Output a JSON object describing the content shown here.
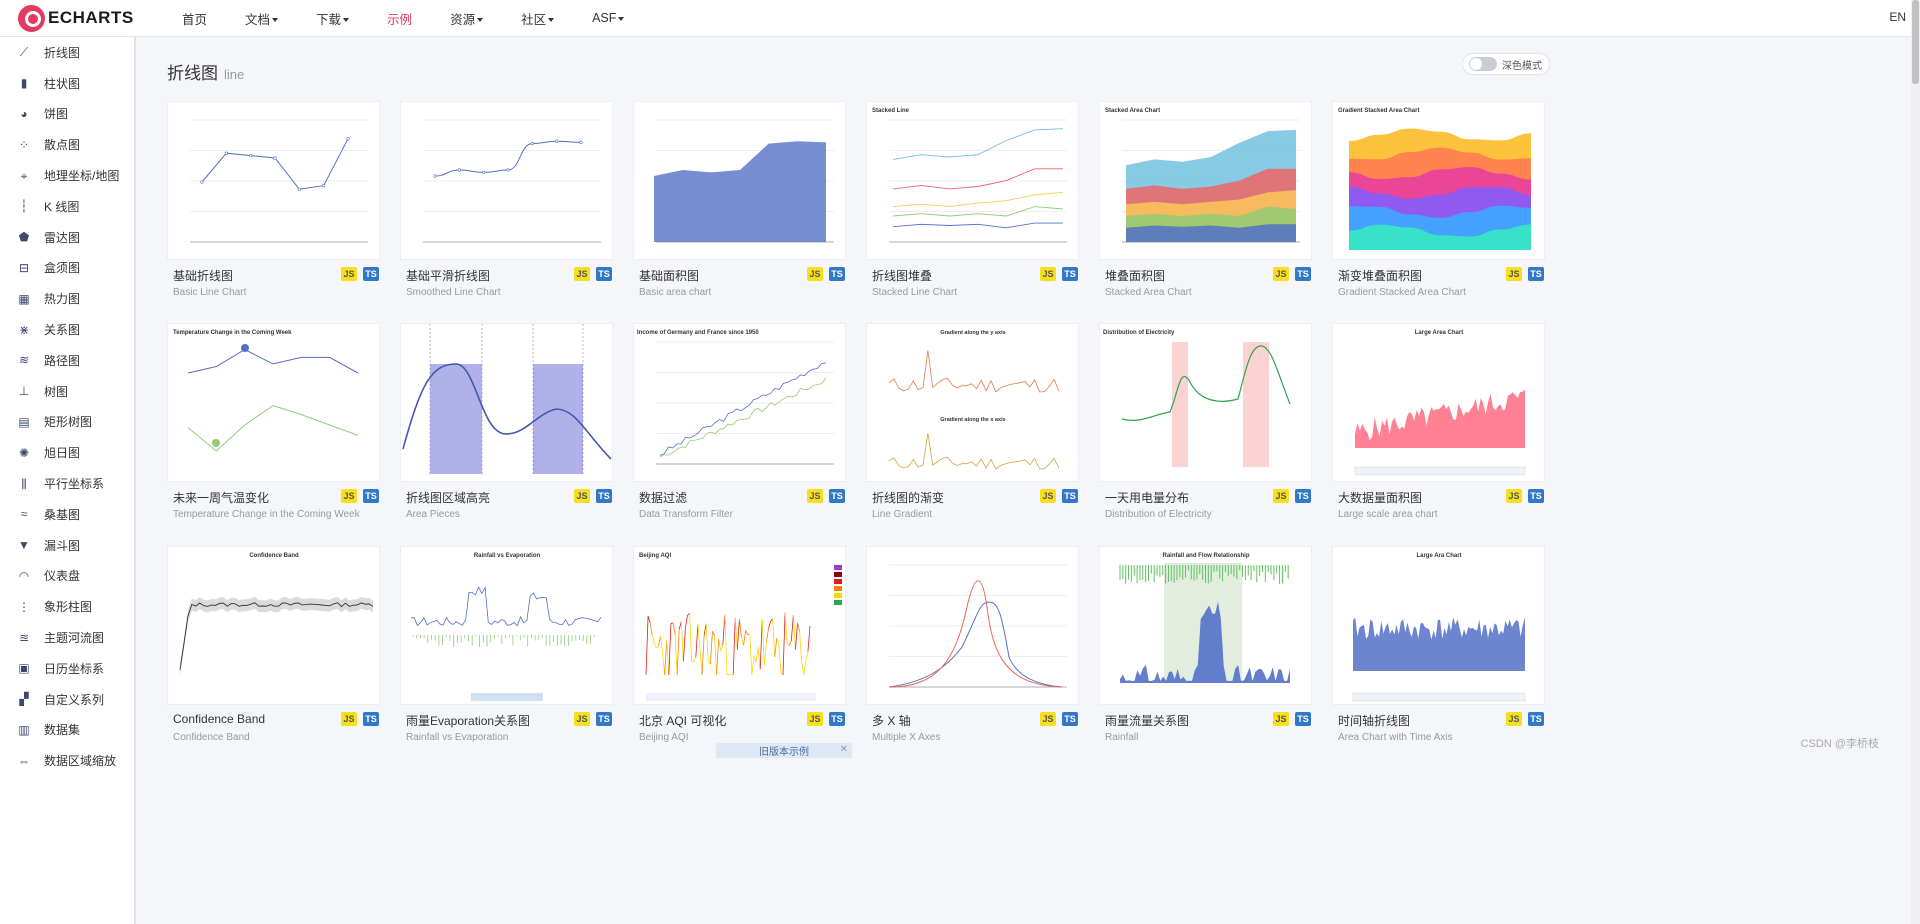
{
  "brand": {
    "logo_text": "ECHARTS",
    "accent": "#e43961"
  },
  "nav": {
    "items": [
      {
        "label": "首页",
        "dropdown": false,
        "active": false
      },
      {
        "label": "文档",
        "dropdown": true,
        "active": false
      },
      {
        "label": "下载",
        "dropdown": true,
        "active": false
      },
      {
        "label": "示例",
        "dropdown": false,
        "active": true
      },
      {
        "label": "资源",
        "dropdown": true,
        "active": false
      },
      {
        "label": "社区",
        "dropdown": true,
        "active": false
      },
      {
        "label": "ASF",
        "dropdown": true,
        "active": false
      }
    ],
    "lang": "EN"
  },
  "sidebar": {
    "items": [
      {
        "label": "折线图",
        "icon": "line-chart-icon",
        "glyph": "⟋"
      },
      {
        "label": "柱状图",
        "icon": "bar-chart-icon",
        "glyph": "▮"
      },
      {
        "label": "饼图",
        "icon": "pie-chart-icon",
        "glyph": "◕"
      },
      {
        "label": "散点图",
        "icon": "scatter-icon",
        "glyph": "⁘"
      },
      {
        "label": "地理坐标/地图",
        "icon": "map-icon",
        "glyph": "⌖"
      },
      {
        "label": "K 线图",
        "icon": "candlestick-icon",
        "glyph": "┆"
      },
      {
        "label": "雷达图",
        "icon": "radar-icon",
        "glyph": "⬟"
      },
      {
        "label": "盒须图",
        "icon": "boxplot-icon",
        "glyph": "⊟"
      },
      {
        "label": "热力图",
        "icon": "heatmap-icon",
        "glyph": "▦"
      },
      {
        "label": "关系图",
        "icon": "graph-icon",
        "glyph": "⋇"
      },
      {
        "label": "路径图",
        "icon": "lines-icon",
        "glyph": "≋"
      },
      {
        "label": "树图",
        "icon": "tree-icon",
        "glyph": "⊥"
      },
      {
        "label": "矩形树图",
        "icon": "treemap-icon",
        "glyph": "▤"
      },
      {
        "label": "旭日图",
        "icon": "sunburst-icon",
        "glyph": "✺"
      },
      {
        "label": "平行坐标系",
        "icon": "parallel-icon",
        "glyph": "⫼"
      },
      {
        "label": "桑基图",
        "icon": "sankey-icon",
        "glyph": "≈"
      },
      {
        "label": "漏斗图",
        "icon": "funnel-icon",
        "glyph": "▼"
      },
      {
        "label": "仪表盘",
        "icon": "gauge-icon",
        "glyph": "◠"
      },
      {
        "label": "象形柱图",
        "icon": "pictorial-bar-icon",
        "glyph": "⋮"
      },
      {
        "label": "主题河流图",
        "icon": "theme-river-icon",
        "glyph": "≊"
      },
      {
        "label": "日历坐标系",
        "icon": "calendar-icon",
        "glyph": "▣"
      },
      {
        "label": "自定义系列",
        "icon": "custom-series-icon",
        "glyph": "▞"
      },
      {
        "label": "数据集",
        "icon": "dataset-icon",
        "glyph": "▥"
      },
      {
        "label": "数据区域缩放",
        "icon": "datazoom-icon",
        "glyph": "⇔"
      }
    ]
  },
  "header": {
    "title": "折线图",
    "subtitle": "line"
  },
  "dark_mode": {
    "label": "深色模式"
  },
  "cards": [
    {
      "title": "基础折线图",
      "subtitle": "Basic Line Chart",
      "kind": "line"
    },
    {
      "title": "基础平滑折线图",
      "subtitle": "Smoothed Line Chart",
      "kind": "smooth"
    },
    {
      "title": "基础面积图",
      "subtitle": "Basic area chart",
      "kind": "area"
    },
    {
      "title": "折线图堆叠",
      "subtitle": "Stacked Line Chart",
      "kind": "stacked-line",
      "label": "Stacked Line"
    },
    {
      "title": "堆叠面积图",
      "subtitle": "Stacked Area Chart",
      "kind": "stacked-area",
      "label": "Stacked Area Chart"
    },
    {
      "title": "渐变堆叠面积图",
      "subtitle": "Gradient Stacked Area Chart",
      "kind": "gradient-stack",
      "label": "Gradient Stacked Area Chart"
    },
    {
      "title": "未来一周气温变化",
      "subtitle": "Temperature Change in the Coming Week",
      "kind": "temperature",
      "label": "Temperature Change in the Coming Week"
    },
    {
      "title": "折线图区域高亮",
      "subtitle": "Area Pieces",
      "kind": "pieces"
    },
    {
      "title": "数据过滤",
      "subtitle": "Data Transform Filter",
      "kind": "filter",
      "label": "Income of Germany and France since 1950"
    },
    {
      "title": "折线图的渐变",
      "subtitle": "Line Gradient",
      "kind": "gradient-line",
      "label": "Gradient along the y axis",
      "label2": "Gradient along the x axis"
    },
    {
      "title": "一天用电量分布",
      "subtitle": "Distribution of Electricity",
      "kind": "electricity",
      "label": "Distribution of Electricity"
    },
    {
      "title": "大数据量面积图",
      "subtitle": "Large scale area chart",
      "kind": "large-area",
      "label": "Large Area Chart"
    },
    {
      "title": "Confidence Band",
      "subtitle": "Confidence Band",
      "kind": "confidence",
      "label": "Confidence Band"
    },
    {
      "title": "雨量Evaporation关系图",
      "subtitle": "Rainfall vs Evaporation",
      "kind": "rainfall",
      "label": "Rainfall vs Evaporation"
    },
    {
      "title": "北京 AQI 可视化",
      "subtitle": "Beijing AQI",
      "kind": "aqi",
      "label": "Beijing AQI"
    },
    {
      "title": "多 X 轴",
      "subtitle": "Multiple X Axes",
      "kind": "multi-x"
    },
    {
      "title": "雨量流量关系图",
      "subtitle": "Rainfall",
      "kind": "rain-flow",
      "label": "Rainfall and Flow Relationship"
    },
    {
      "title": "时间轴折线图",
      "subtitle": "Area Chart with Time Axis",
      "kind": "time-area",
      "label": "Large Ara Chart"
    }
  ],
  "badges": {
    "js": "JS",
    "ts": "TS"
  },
  "old_version": {
    "label": "旧版本示例"
  },
  "watermark": "CSDN @李桥枝",
  "colors": {
    "blue": "#5470c6",
    "green": "#91cc75",
    "yellow": "#fac858",
    "red": "#ee6666",
    "cyan": "#73c0de",
    "purple": "#9a60b4"
  }
}
